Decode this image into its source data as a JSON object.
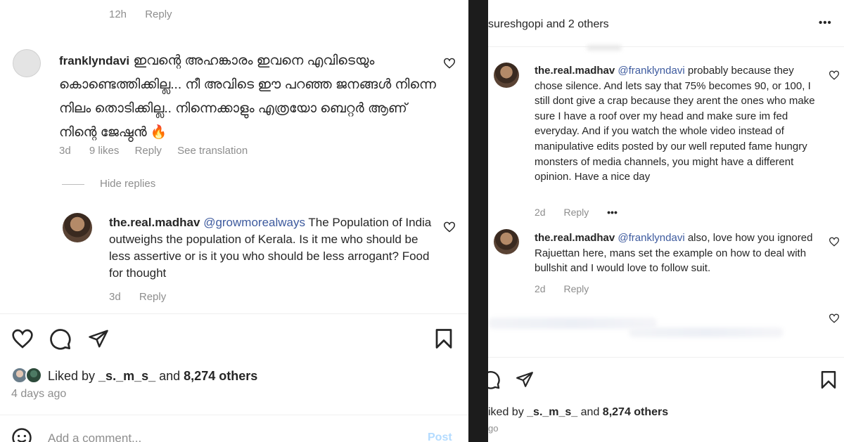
{
  "left": {
    "top_meta": {
      "time": "12h",
      "reply": "Reply"
    },
    "comment1": {
      "username": "franklyndavi",
      "text": "ഇവന്റെ അഹങ്കാരം ഇവനെ എവിടെയും കൊണ്ടെത്തിക്കില്ല... നീ അവിടെ ഈ പറഞ്ഞ ജനങ്ങൾ നിന്നെ നിലം തൊടിക്കില്ല.. നിന്നെക്കാളും എത്രയോ ബെറ്റർ ആണ് നിന്റെ ജേഷ്ഠൻ 🔥",
      "time": "3d",
      "likes": "9 likes",
      "reply": "Reply",
      "translation": "See translation"
    },
    "hide_replies": "Hide replies",
    "reply1": {
      "username": "the.real.madhav",
      "mention": "@growmorealways",
      "text": " The Population of India outweighs the population of Kerala. Is it me who should be less assertive or is it you who should be less arrogant? Food for thought",
      "time": "3d",
      "reply": "Reply"
    },
    "liked_by": {
      "prefix": "Liked by ",
      "user": "_s._m_s_",
      "middle": " and ",
      "count": "8,274 others"
    },
    "age": "4 days ago",
    "add_comment": "Add a comment...",
    "post": "Post"
  },
  "right": {
    "header": {
      "title": "sureshgopi and 2 others",
      "more": "•••"
    },
    "comment1": {
      "username": "the.real.madhav",
      "mention": "@franklyndavi",
      "text": " probably because they chose silence. And lets say that 75% becomes 90, or 100, I still dont give a crap because they arent the ones who make sure I have a roof over my head and make sure im fed everyday. And if you watch the whole video instead of manipulative edits posted by our well reputed fame hungry monsters of media channels, you might have a different opinion. Have a nice day",
      "time": "2d",
      "reply": "Reply",
      "more": "•••"
    },
    "comment2": {
      "username": "the.real.madhav",
      "mention": "@franklyndavi",
      "text": " also, love how you ignored Rajuettan here, mans set the example on how to deal with bullshit and I would love to follow suit.",
      "time": "2d",
      "reply": "Reply"
    },
    "liked_by": {
      "prefix": "iked by ",
      "user": "_s._m_s_",
      "middle": " and ",
      "count": "8,274 others"
    },
    "age": "go"
  },
  "colors": {
    "mention": "#3d5a9e",
    "muted": "#8e8e8e",
    "divider": "#1c1c1c"
  }
}
